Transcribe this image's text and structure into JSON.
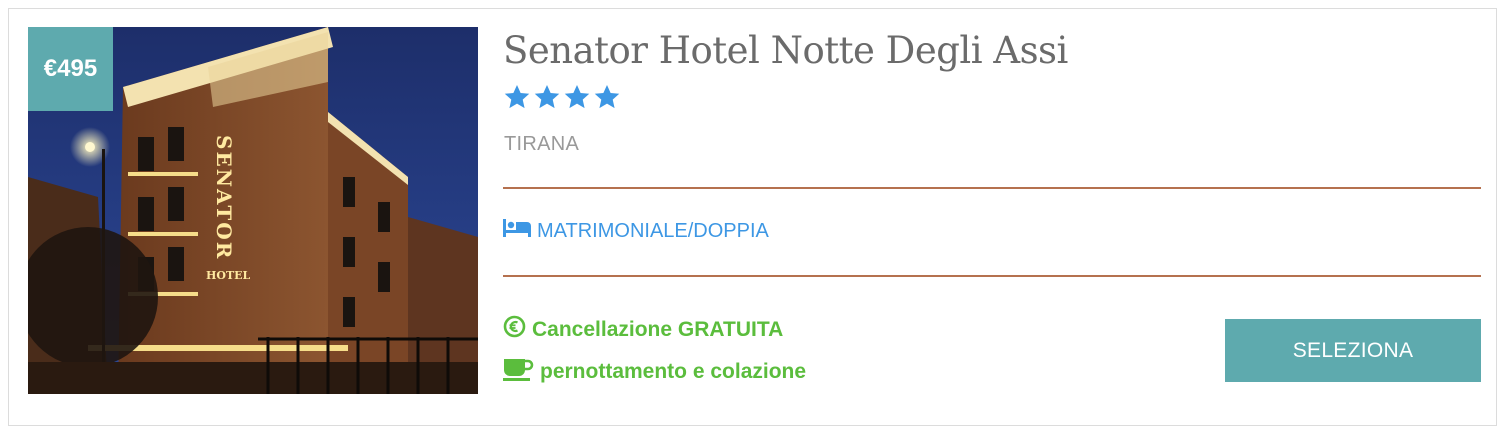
{
  "hotel": {
    "price": "€495",
    "name": "Senator Hotel Notte Degli Assi",
    "stars": 4,
    "city": "TIRANA",
    "room_type": "MATRIMONIALE/DOPPIA",
    "cancellation": "Cancellazione GRATUITA",
    "board": "pernottamento e colazione",
    "select_label": "SELEZIONA",
    "photo_sign": "SENATOR",
    "photo_sign_sub": "HOTEL"
  },
  "icons": {
    "star": "star-icon",
    "room": "bed-icon",
    "cancellation": "euro-circle-icon",
    "board": "coffee-cup-icon"
  },
  "colors": {
    "accent": "#5eaaae",
    "star": "#3d97e4",
    "room": "#3d97e4",
    "feature": "#5bbd3d",
    "divider": "#b5714f",
    "title": "#6b6b6b",
    "city": "#999999"
  }
}
